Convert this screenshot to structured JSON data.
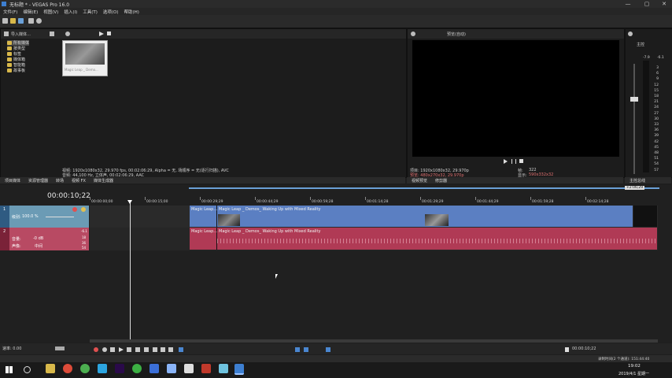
{
  "window": {
    "title": "无标题 * - VEGAS Pro 16.0",
    "controls": [
      "—",
      "▢",
      "✕"
    ]
  },
  "menu": [
    "文件(F)",
    "编辑(E)",
    "视图(V)",
    "插入(I)",
    "工具(T)",
    "选项(O)",
    "帮助(H)"
  ],
  "explorer": {
    "import_label": "导入媒体…",
    "tree": [
      "所有媒体",
      "按类型",
      "标签",
      "媒体箱",
      "智能箱",
      "故事板"
    ],
    "thumb_caption": "Magic Leap _ Demo...",
    "info_line1": "视频: 1920x1080x32, 29.970 fps, 00:02:06:29, Alpha = 无, 场顺序 = 无(逐行扫描), AVC",
    "info_line2": "音频: 44,100 Hz, 立体声, 00:02:06:29, AAC"
  },
  "left_tabs": [
    "项目媒体",
    "资源管理器",
    "转场",
    "视频 FX",
    "媒体生成器"
  ],
  "preview": {
    "quality": "预览(自动)",
    "project_line": "项目: 1920x1080x32, 29.970p",
    "preview_line": "预览: 480x270x32, 29.970p",
    "frame_label": "帧:",
    "frame_value": "322",
    "display_label": "显示:",
    "display_value": "590x332x32",
    "tabs": [
      "视频预览",
      "修剪器"
    ]
  },
  "master": {
    "label": "主控",
    "left_db": "-7.9",
    "right_db": "-6.1",
    "scale": [
      "3",
      "6",
      "9",
      "12",
      "15",
      "18",
      "21",
      "24",
      "27",
      "30",
      "33",
      "36",
      "39",
      "42",
      "45",
      "48",
      "51",
      "54",
      "57"
    ],
    "tab": "主控总线"
  },
  "timeline": {
    "timecode": "00:00:10;22",
    "end_marker": "+2:06;29",
    "ruler": [
      "00:00:00;00",
      "00:00:15;00",
      "00:00:29;29",
      "00:00:44;29",
      "00:00:59;28",
      "00:01:14;28",
      "00:01:29;29",
      "00:01:44;29",
      "00:01:59;28",
      "00:02:14;28"
    ],
    "video_track": {
      "number": "1",
      "level_label": "级别:",
      "level_value": "100.0 %"
    },
    "audio_track": {
      "number": "2",
      "volume_label": "音量:",
      "volume_value": "-0 dB",
      "pan_label": "声像:",
      "pan_value": "中间",
      "meter_value": "-6.1",
      "meter_scale": [
        "18",
        "36",
        "54"
      ]
    },
    "clip_short": "Magic Leap...",
    "clip_full": "Magic Leap _ Demos_ Waking Up with Mixed Reality",
    "rate_label": "速率: 0.00",
    "bottom_timecode": "00:00:10;22"
  },
  "status": {
    "record_time": "录制时间(2 个通道): 151:44:40",
    "clock_time": "19:02",
    "clock_date": "2019/4/1 星期一"
  },
  "colors": {
    "video_clip": "#5b7fc2",
    "audio_clip": "#b03a55",
    "video_header": "#6b9bb5",
    "audio_header": "#b84a63"
  }
}
